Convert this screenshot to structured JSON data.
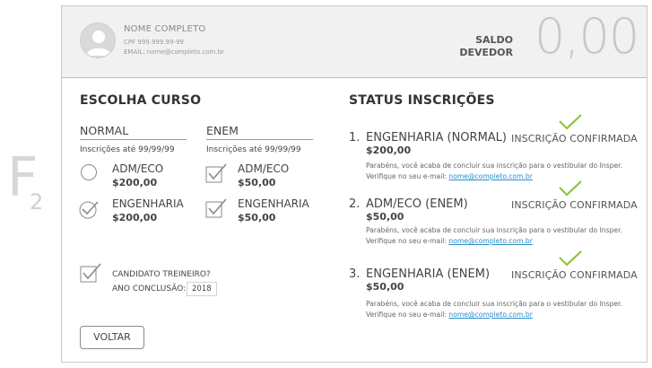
{
  "side_mark": {
    "letter": "F",
    "sub": "2"
  },
  "user": {
    "name": "NOME COMPLETO",
    "cpf": "CPF 999.999.99-99",
    "email": "EMAIL: nome@completo.com.br"
  },
  "balance": {
    "label_line1": "SALDO",
    "label_line2": "DEVEDOR",
    "value": "0,00"
  },
  "course_section": {
    "title": "ESCOLHA CURSO",
    "columns": [
      {
        "heading": "NORMAL",
        "deadline": "Inscrições até 99/99/99",
        "options": [
          {
            "name": "ADM/ECO",
            "price": "$200,00",
            "control": "radio",
            "selected": false
          },
          {
            "name": "ENGENHARIA",
            "price": "$200,00",
            "control": "radio",
            "selected": true
          }
        ]
      },
      {
        "heading": "ENEM",
        "deadline": "Inscrições até 99/99/99",
        "options": [
          {
            "name": "ADM/ECO",
            "price": "$50,00",
            "control": "checkbox",
            "selected": true
          },
          {
            "name": "ENGENHARIA",
            "price": "$50,00",
            "control": "checkbox",
            "selected": true
          }
        ]
      }
    ],
    "trainee_label": "CANDIDATO TREINEIRO?",
    "year_label": "ANO CONCLUSÃO:",
    "year_value": "2018",
    "back_button": "VOLTAR"
  },
  "status_section": {
    "title": "STATUS INSCRIÇÕES",
    "items": [
      {
        "number": "1.",
        "name": "ENGENHARIA (NORMAL)",
        "price": "$200,00",
        "status": "INSCRIÇÃO CONFIRMADA",
        "message": "Parabéns, você acaba de concluir sua inscrição para o vestibular do Insper.",
        "email_prefix": "Verifique no seu e-mail:",
        "email": "nome@completo.com.br"
      },
      {
        "number": "2.",
        "name": "ADM/ECO (ENEM)",
        "price": "$50,00",
        "status": "INSCRIÇÃO CONFIRMADA",
        "message": "Parabéns, você acaba de concluir sua inscrição para o vestibular do Insper.",
        "email_prefix": "Verifique no seu e-mail:",
        "email": "nome@completo.com.br"
      },
      {
        "number": "3.",
        "name": "ENGENHARIA (ENEM)",
        "price": "$50,00",
        "status": "INSCRIÇÃO CONFIRMADA",
        "message": "Parabéns, você acaba de concluir sua inscrição para o vestibular do Insper.",
        "email_prefix": "Verifique no seu e-mail:",
        "email": "nome@completo.com.br"
      }
    ]
  },
  "colors": {
    "accent_green": "#8dc63f",
    "link_blue": "#2a8cc8",
    "header_bg": "#f1f1f1"
  }
}
